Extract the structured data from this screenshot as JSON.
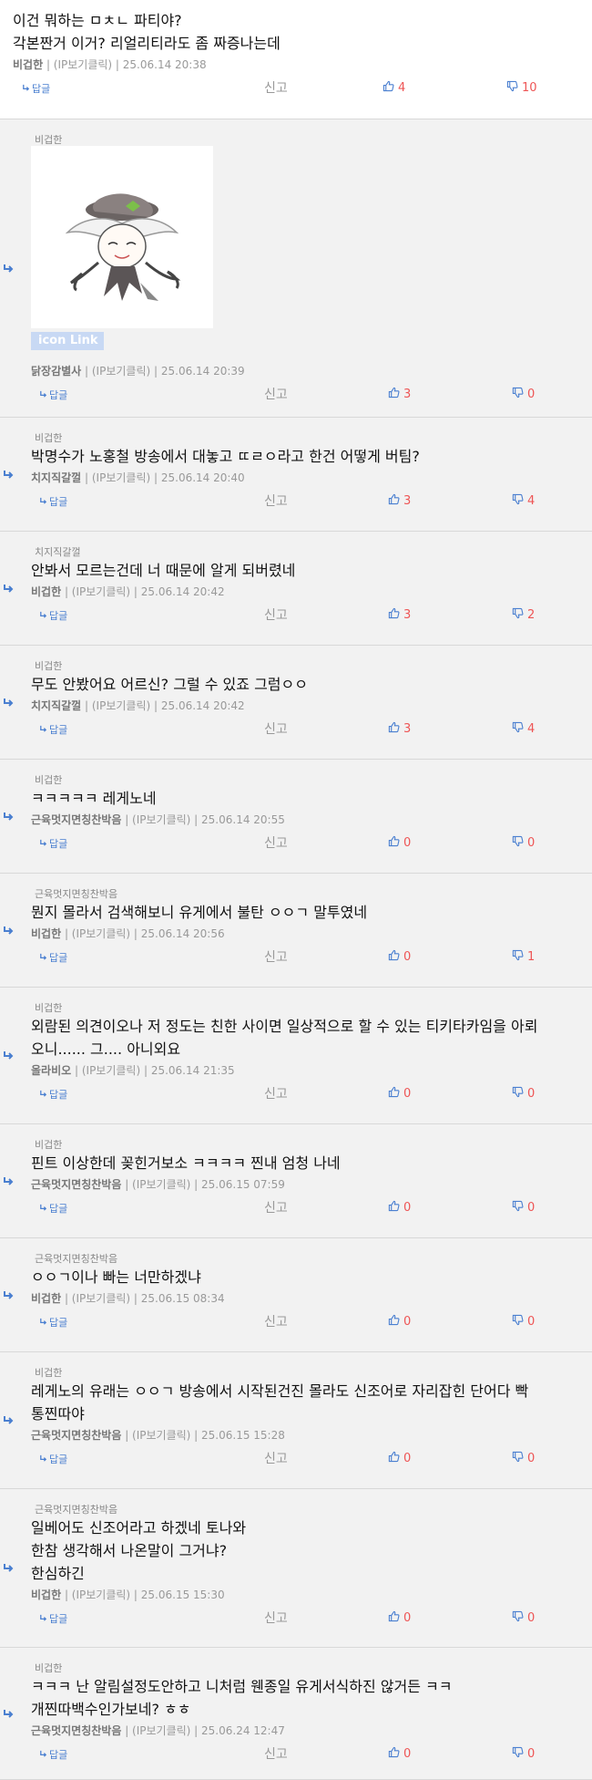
{
  "labels": {
    "reply": "답글",
    "report": "신고",
    "ip_hint": "(IP보기클릭)"
  },
  "colors": {
    "accent": "#4a7fd0",
    "vote": "#ee5555",
    "meta": "#999999"
  },
  "comments": [
    {
      "tag": "",
      "lines": [
        "이건 뭐하는 ㅁㅊㄴ 파티야?",
        "각본짠거 이거? 리얼리티라도 좀 짜증나는데"
      ],
      "nick": "비겁한",
      "date": "25.06.14 20:38",
      "up": "4",
      "down": "10"
    },
    {
      "tag": "비겁한",
      "lines": [],
      "image": true,
      "image_link": "icon Link",
      "nick": "닭장감별사",
      "date": "25.06.14 20:39",
      "up": "3",
      "down": "0"
    },
    {
      "tag": "비겁한",
      "lines": [
        "박명수가 노홍철 방송에서 대놓고 ㄸㄹㅇ라고 한건 어떻게 버팀?"
      ],
      "nick": "치지직갈껄",
      "date": "25.06.14 20:40",
      "up": "3",
      "down": "4"
    },
    {
      "tag": "치지직갈껄",
      "lines": [
        "안봐서 모르는건데 너 때문에 알게 되버렸네"
      ],
      "nick": "비겁한",
      "date": "25.06.14 20:42",
      "up": "3",
      "down": "2"
    },
    {
      "tag": "비겁한",
      "lines": [
        "무도 안봤어요 어르신? 그럴 수 있죠 그럼ㅇㅇ"
      ],
      "nick": "치지직갈껄",
      "date": "25.06.14 20:42",
      "up": "3",
      "down": "4"
    },
    {
      "tag": "비겁한",
      "lines": [
        "ㅋㅋㅋㅋㅋ 레게노네"
      ],
      "nick": "근육멋지면칭찬박음",
      "date": "25.06.14 20:55",
      "up": "0",
      "down": "0"
    },
    {
      "tag": "근육멋지면칭찬박음",
      "lines": [
        "뭔지 몰라서 검색해보니 유게에서 불탄 ㅇㅇㄱ 말투였네"
      ],
      "nick": "비겁한",
      "date": "25.06.14 20:56",
      "up": "0",
      "down": "1"
    },
    {
      "tag": "비겁한",
      "lines": [
        "외람된 의견이오나 저 정도는 친한 사이면 일상적으로 할 수 있는 티키타카임을 아뢰",
        "오니...... 그.... 아니외요"
      ],
      "nick": "올라비오",
      "date": "25.06.14 21:35",
      "up": "0",
      "down": "0"
    },
    {
      "tag": "비겁한",
      "lines": [
        "핀트 이상한데 꽂힌거보소 ㅋㅋㅋㅋ 찐내 엄청 나네"
      ],
      "nick": "근육멋지면칭찬박음",
      "date": "25.06.15 07:59",
      "up": "0",
      "down": "0"
    },
    {
      "tag": "근육멋지면칭찬박음",
      "lines": [
        "ㅇㅇㄱ이나 빠는 너만하겠냐"
      ],
      "nick": "비겁한",
      "date": "25.06.15 08:34",
      "up": "0",
      "down": "0"
    },
    {
      "tag": "비겁한",
      "lines": [
        "레게노의 유래는 ㅇㅇㄱ 방송에서 시작된건진 몰라도 신조어로 자리잡힌 단어다 빡",
        "통찐따야"
      ],
      "nick": "근육멋지면칭찬박음",
      "date": "25.06.15 15:28",
      "up": "0",
      "down": "0"
    },
    {
      "tag": "근육멋지면칭찬박음",
      "lines": [
        "일베어도 신조어라고 하겠네 토나와",
        "한참 생각해서 나온말이 그거냐?",
        "한심하긴"
      ],
      "nick": "비겁한",
      "date": "25.06.15 15:30",
      "up": "0",
      "down": "0"
    },
    {
      "tag": "비겁한",
      "lines": [
        "ㅋㅋㅋ 난 알림설정도안하고 니처럼 웬종일 유게서식하진 않거든 ㅋㅋ",
        "개찐따백수인가보네? ㅎㅎ"
      ],
      "nick": "근육멋지면칭찬박음",
      "date": "25.06.24 12:47",
      "up": "0",
      "down": "0"
    }
  ]
}
